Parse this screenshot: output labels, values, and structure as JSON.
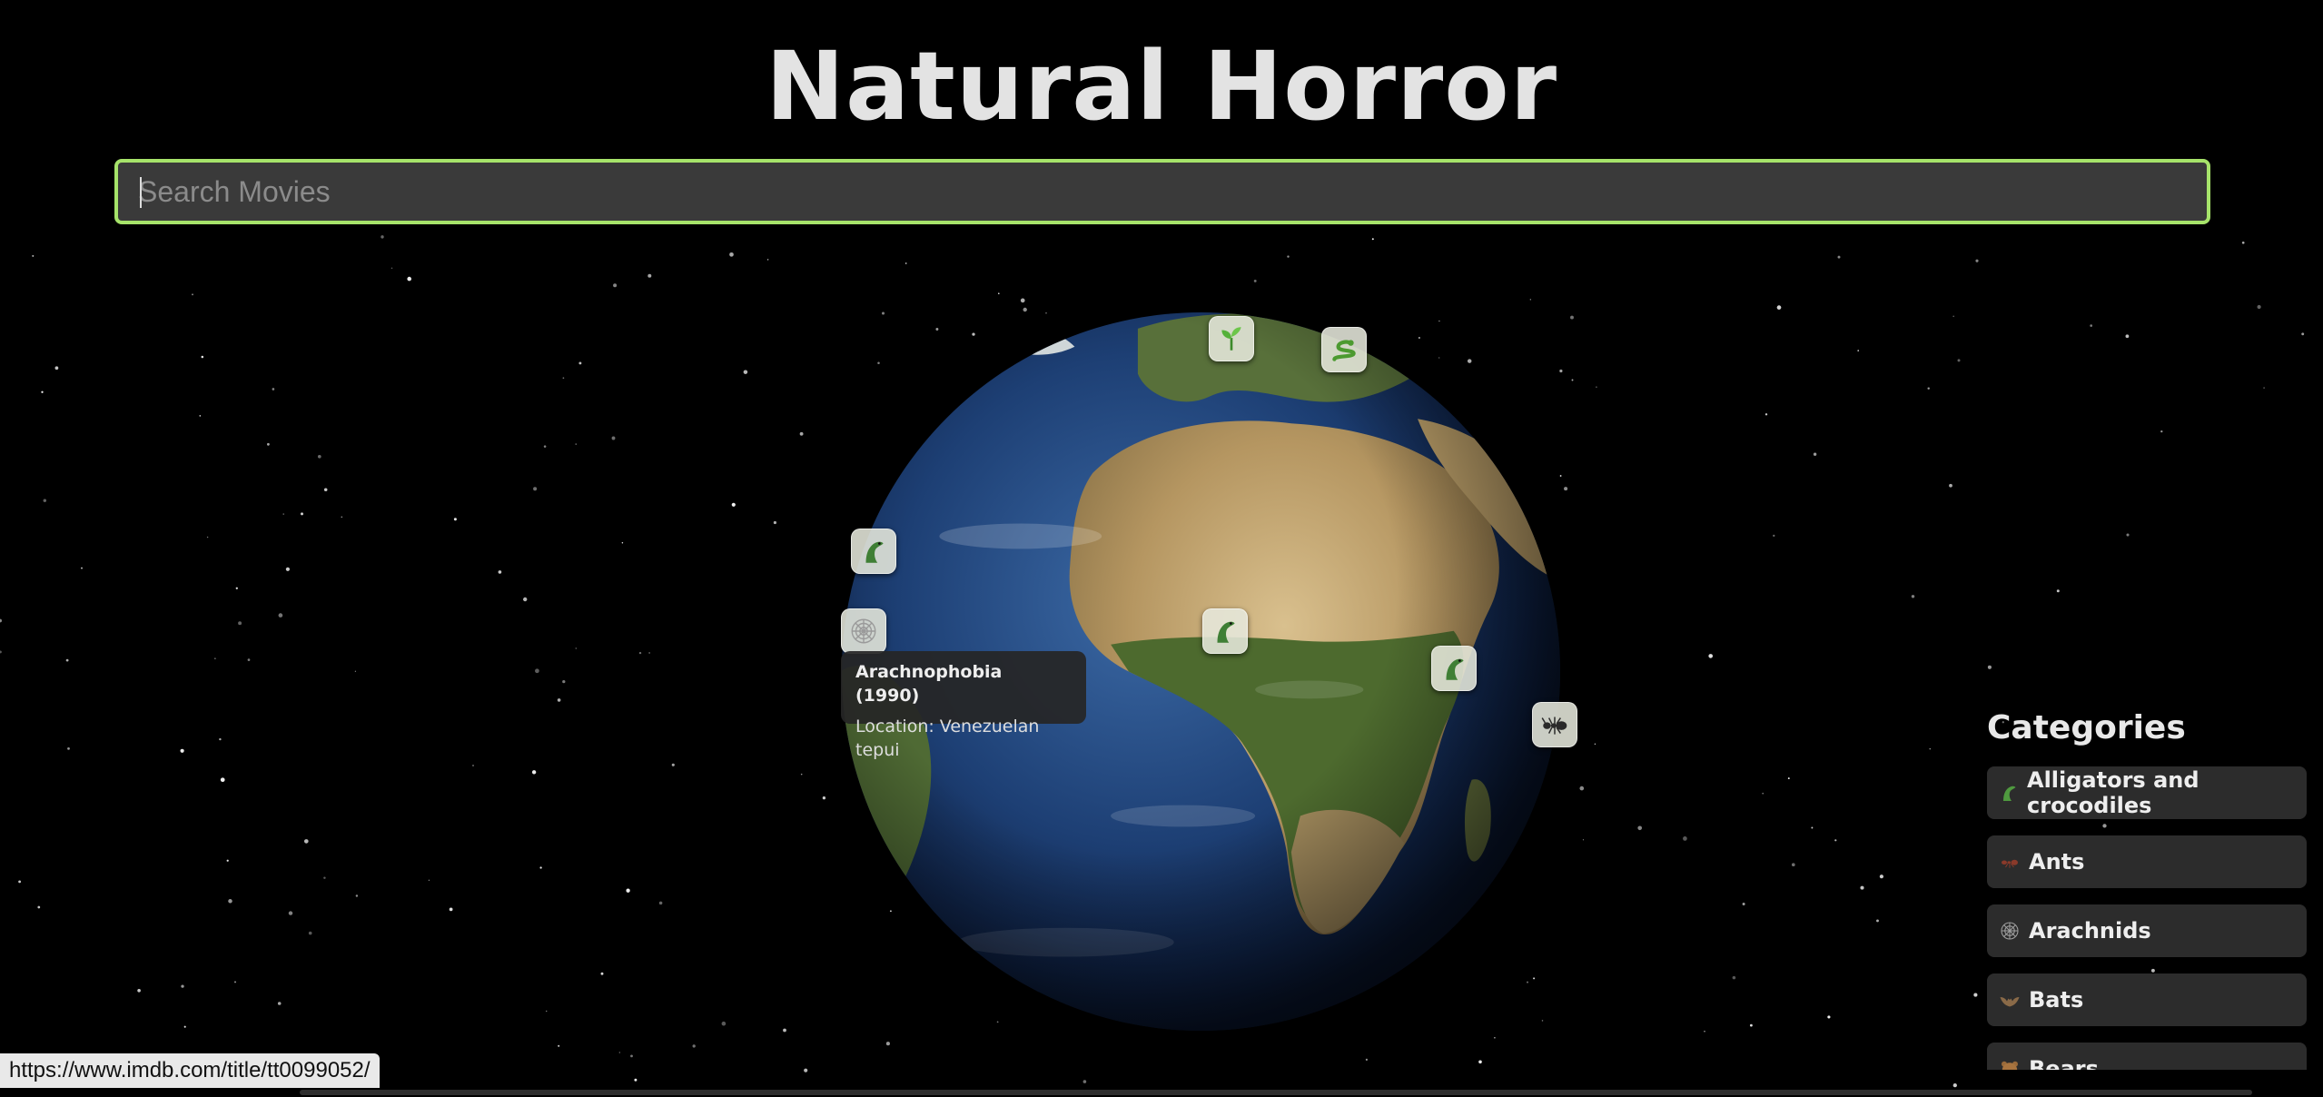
{
  "app": {
    "title": "Natural Horror"
  },
  "search": {
    "placeholder": "Search Movies",
    "value": ""
  },
  "globe": {
    "markers": [
      {
        "icon": "seedling-icon",
        "category": "Plants"
      },
      {
        "icon": "snake-icon",
        "category": "Snakes"
      },
      {
        "icon": "crocodile-icon",
        "category": "Alligators and crocodiles"
      },
      {
        "icon": "spider-web-icon",
        "category": "Arachnids"
      },
      {
        "icon": "crocodile-icon",
        "category": "Alligators and crocodiles"
      },
      {
        "icon": "crocodile-icon",
        "category": "Alligators and crocodiles"
      },
      {
        "icon": "ant-icon",
        "category": "Ants"
      }
    ],
    "tooltip": {
      "title": "Arachnophobia (1990)",
      "location": "Location: Venezuelan tepui"
    }
  },
  "categories": {
    "heading": "Categories",
    "items": [
      {
        "label": "Alligators and crocodiles",
        "icon": "crocodile-icon"
      },
      {
        "label": "Ants",
        "icon": "ant-icon"
      },
      {
        "label": "Arachnids",
        "icon": "spider-web-icon"
      },
      {
        "label": "Bats",
        "icon": "bat-icon"
      },
      {
        "label": "Bears",
        "icon": "bear-icon"
      }
    ]
  },
  "status_bar": {
    "url": "https://www.imdb.com/title/tt0099052/"
  },
  "colors": {
    "accent": "#a6e36a",
    "background": "#000000",
    "panel": "#2c2c2c",
    "title_text": "#e3e3e3"
  }
}
